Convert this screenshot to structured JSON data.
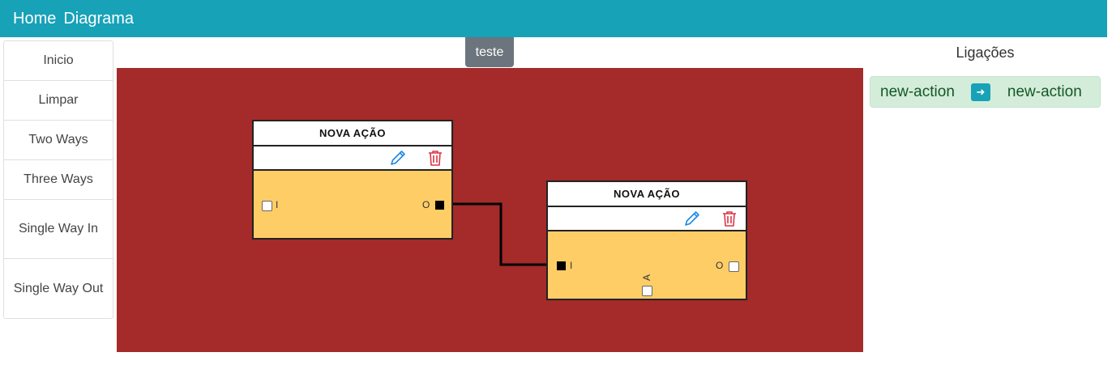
{
  "navbar": {
    "brand": "Home",
    "link": "Diagrama",
    "color": "#17a2b8"
  },
  "sidebar": {
    "items": [
      {
        "label": "Inicio"
      },
      {
        "label": "Limpar"
      },
      {
        "label": "Two Ways"
      },
      {
        "label": "Three Ways"
      },
      {
        "label": "Single Way In"
      },
      {
        "label": "Single Way Out"
      }
    ]
  },
  "toolbar": {
    "teste_label": "teste"
  },
  "canvas": {
    "background": "#a52a2a"
  },
  "nodes": [
    {
      "title": "NOVA AÇÃO",
      "input_label": "I",
      "output_label": "O",
      "icons": [
        "pencil-icon",
        "trash-icon"
      ]
    },
    {
      "title": "NOVA AÇÃO",
      "input_label": "I",
      "output_label": "O",
      "extra_label": "A",
      "icons": [
        "pencil-icon",
        "trash-icon"
      ]
    }
  ],
  "ligacoes": {
    "title": "Ligações",
    "items": [
      {
        "from": "new-action",
        "arrow_icon": "arrow-right-icon",
        "to": "new-action"
      }
    ]
  }
}
